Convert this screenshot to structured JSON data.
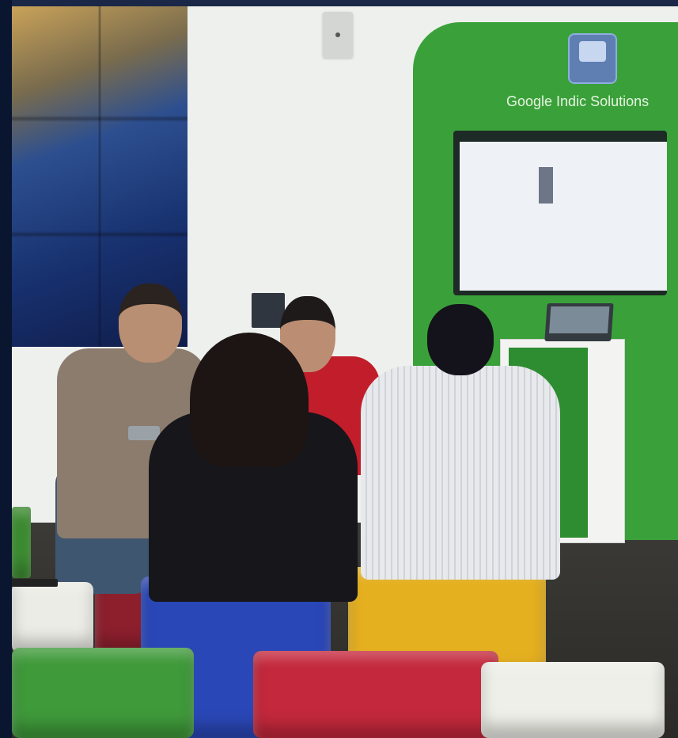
{
  "scene": {
    "description_alt": "",
    "booth_sign": "Google Indic Solutions"
  },
  "colors": {
    "booth_green": "#3aa13a",
    "stool_blue": "#2a47b7",
    "stool_yellow": "#e5b020",
    "stool_red": "#c4283c",
    "stool_green": "#3f9a3a",
    "stool_white": "#efefe9"
  },
  "icons": {
    "booth_logo": "keyboard-badge-icon"
  }
}
